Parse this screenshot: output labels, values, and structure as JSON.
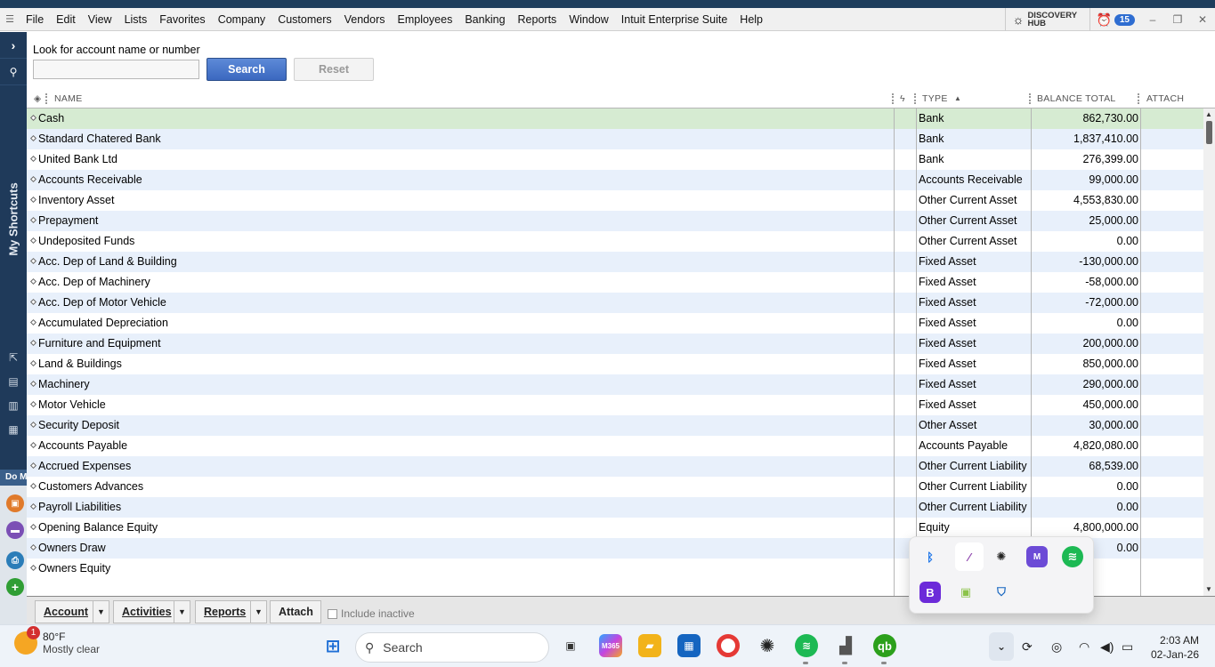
{
  "menubar": {
    "items": [
      "File",
      "Edit",
      "View",
      "Lists",
      "Favorites",
      "Company",
      "Customers",
      "Vendors",
      "Employees",
      "Banking",
      "Reports",
      "Window",
      "Intuit Enterprise Suite",
      "Help"
    ],
    "discovery_hub": "DISCOVERY HUB",
    "alerts_count": "15"
  },
  "sidebar": {
    "title": "My Shortcuts",
    "do_more": "Do More",
    "badge": "1"
  },
  "search": {
    "label": "Look for account name or number",
    "value": "",
    "search_button": "Search",
    "reset_button": "Reset"
  },
  "columns": {
    "name": "NAME",
    "type": "TYPE",
    "balance": "BALANCE TOTAL",
    "attach": "ATTACH"
  },
  "accounts": [
    {
      "name": "Cash",
      "type": "Bank",
      "balance": "862,730.00"
    },
    {
      "name": "Standard Chatered Bank",
      "type": "Bank",
      "balance": "1,837,410.00"
    },
    {
      "name": "United Bank Ltd",
      "type": "Bank",
      "balance": "276,399.00"
    },
    {
      "name": "Accounts Receivable",
      "type": "Accounts Receivable",
      "balance": "99,000.00"
    },
    {
      "name": "Inventory Asset",
      "type": "Other Current Asset",
      "balance": "4,553,830.00"
    },
    {
      "name": "Prepayment",
      "type": "Other Current Asset",
      "balance": "25,000.00"
    },
    {
      "name": "Undeposited Funds",
      "type": "Other Current Asset",
      "balance": "0.00"
    },
    {
      "name": "Acc. Dep of Land & Building",
      "type": "Fixed Asset",
      "balance": "-130,000.00"
    },
    {
      "name": "Acc. Dep of Machinery",
      "type": "Fixed Asset",
      "balance": "-58,000.00"
    },
    {
      "name": "Acc. Dep of Motor Vehicle",
      "type": "Fixed Asset",
      "balance": "-72,000.00"
    },
    {
      "name": "Accumulated Depreciation",
      "type": "Fixed Asset",
      "balance": "0.00"
    },
    {
      "name": "Furniture and Equipment",
      "type": "Fixed Asset",
      "balance": "200,000.00"
    },
    {
      "name": "Land & Buildings",
      "type": "Fixed Asset",
      "balance": "850,000.00"
    },
    {
      "name": "Machinery",
      "type": "Fixed Asset",
      "balance": "290,000.00"
    },
    {
      "name": "Motor Vehicle",
      "type": "Fixed Asset",
      "balance": "450,000.00"
    },
    {
      "name": "Security Deposit",
      "type": "Other Asset",
      "balance": "30,000.00"
    },
    {
      "name": "Accounts Payable",
      "type": "Accounts Payable",
      "balance": "4,820,080.00"
    },
    {
      "name": "Accrued Expenses",
      "type": "Other Current Liability",
      "balance": "68,539.00"
    },
    {
      "name": "Customers Advances",
      "type": "Other Current Liability",
      "balance": "0.00"
    },
    {
      "name": "Payroll Liabilities",
      "type": "Other Current Liability",
      "balance": "0.00"
    },
    {
      "name": "Opening Balance Equity",
      "type": "Equity",
      "balance": "4,800,000.00"
    },
    {
      "name": "Owners Draw",
      "type": "",
      "balance": "0.00"
    },
    {
      "name": "Owners Equity",
      "type": "",
      "balance": ""
    }
  ],
  "bottombar": {
    "account": "Account",
    "activities": "Activities",
    "reports": "Reports",
    "attach": "Attach",
    "include_inactive": "Include inactive"
  },
  "taskbar": {
    "temperature": "80°F",
    "weather": "Mostly clear",
    "weather_badge": "1",
    "search_placeholder": "Search",
    "time": "2:03 AM",
    "date": "02-Jan-26"
  },
  "colors": {
    "selected_row": "#d6ebd2",
    "alt_row": "#e8f0fb",
    "search_button": "#3b68bf",
    "sidebar": "#1f3a5a"
  }
}
